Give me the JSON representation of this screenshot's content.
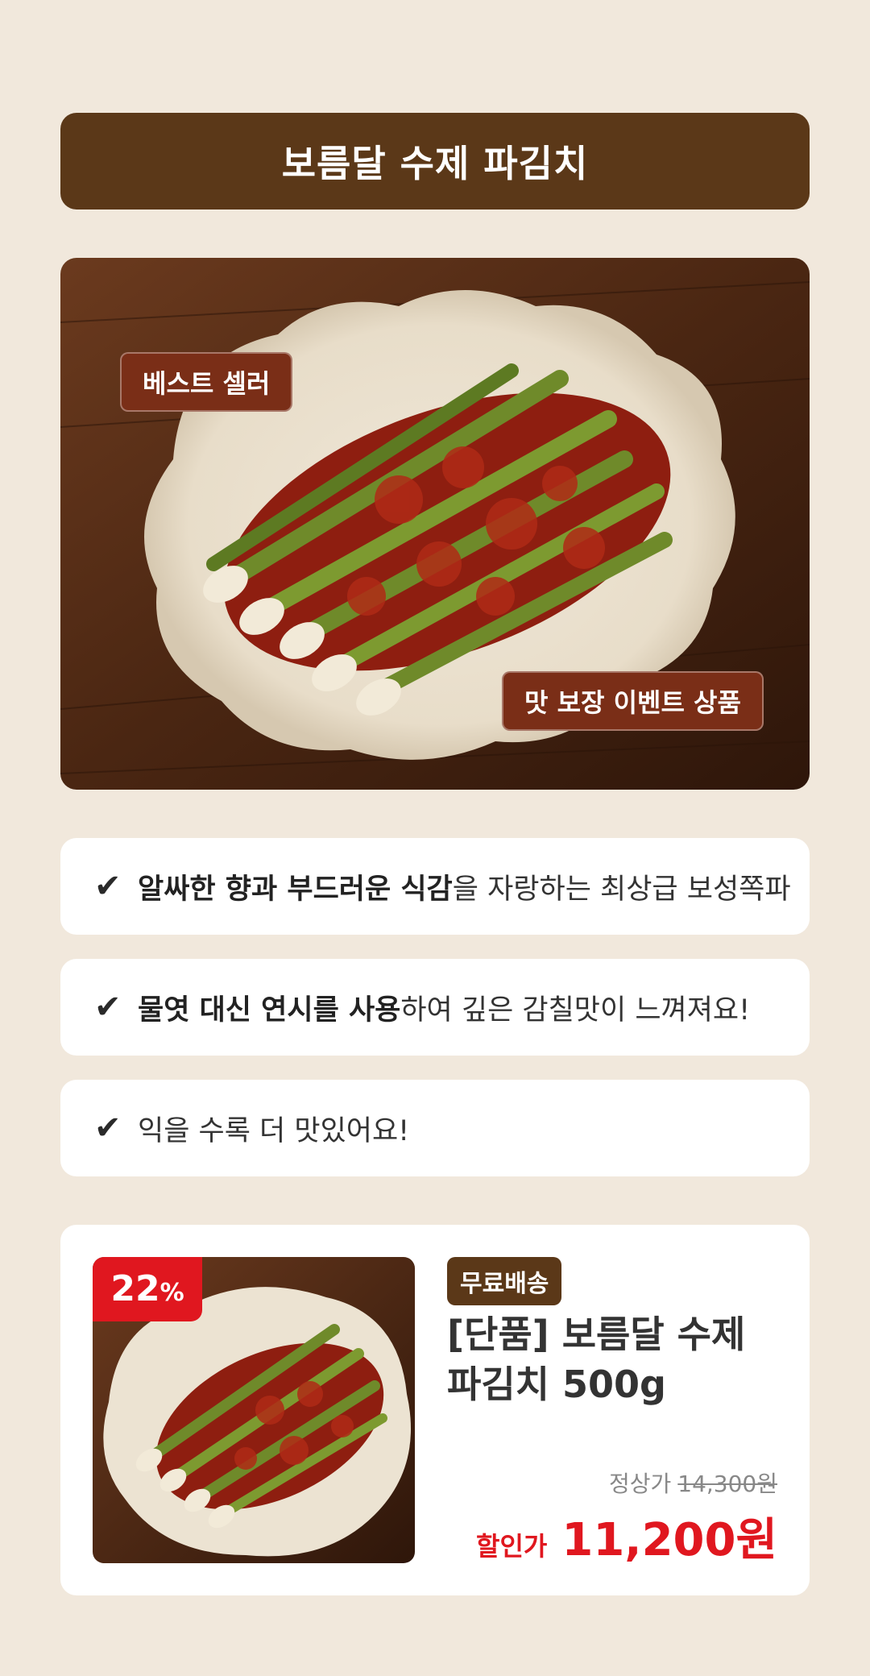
{
  "header": {
    "title": "보름달 수제 파김치"
  },
  "hero": {
    "tags": {
      "best_seller": "베스트 셀러",
      "event": "맛 보장 이벤트 상품"
    }
  },
  "features": [
    {
      "bold": "알싸한 향과 부드러운 식감",
      "rest": "을 자랑하는 최상급 보성쪽파"
    },
    {
      "bold": "물엿 대신 연시를 사용",
      "rest": "하여 깊은 감칠맛이 느껴져요!"
    },
    {
      "bold": "",
      "rest": "익을 수록 더 맛있어요!"
    }
  ],
  "product": {
    "discount": {
      "number": "22",
      "symbol": "%"
    },
    "shipping_badge": "무료배송",
    "name_line1": "[단품] 보름달 수제",
    "name_line2": "파김치 500g",
    "regular_label": "정상가",
    "regular_price": "14,300원",
    "sale_label": "할인가",
    "sale_price": "11,200원"
  },
  "colors": {
    "background": "#F1E8DC",
    "brown": "#5B3818",
    "tag_red_brown": "#7A2E17",
    "sale_red": "#E0171F"
  },
  "icons": [
    "check-icon"
  ]
}
